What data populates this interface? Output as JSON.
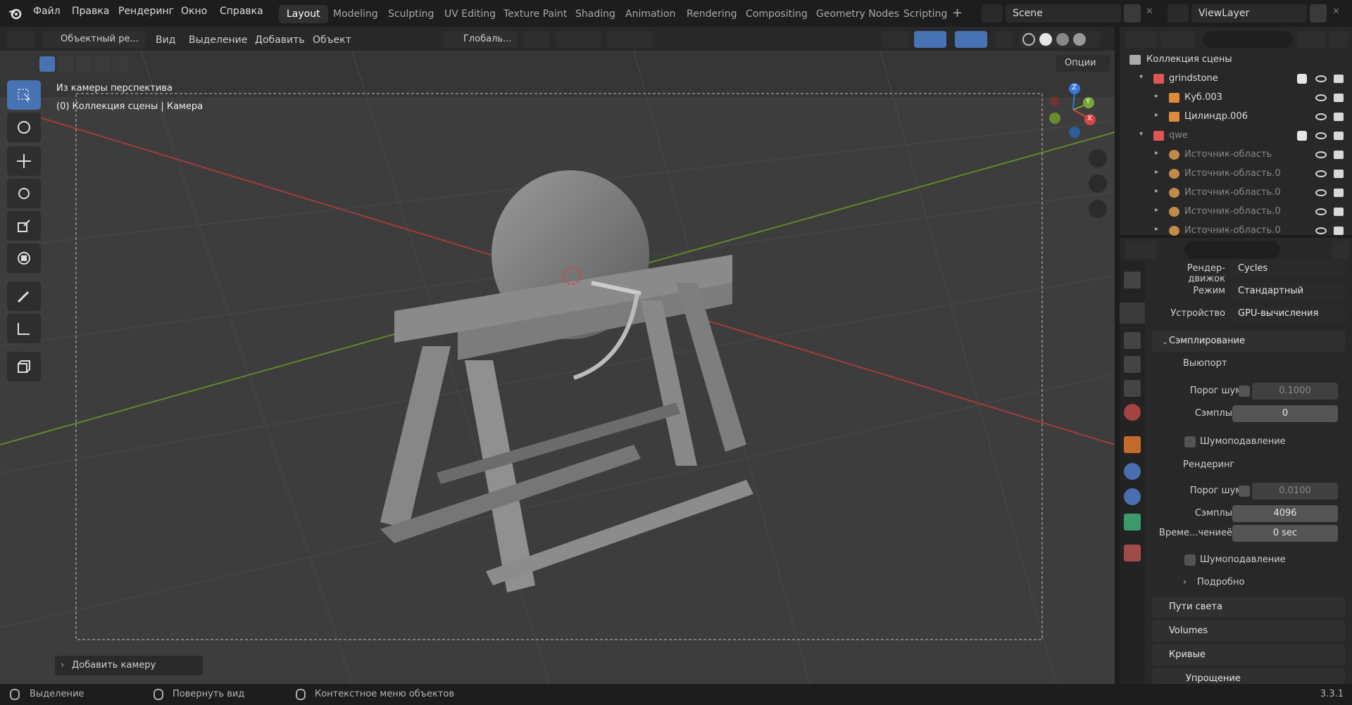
{
  "topbar": {
    "menus": [
      "Файл",
      "Правка",
      "Рендеринг",
      "Окно",
      "Справка"
    ],
    "workspaces": [
      "Layout",
      "Modeling",
      "Sculpting",
      "UV Editing",
      "Texture Paint",
      "Shading",
      "Animation",
      "Rendering",
      "Compositing",
      "Geometry Nodes",
      "Scripting"
    ],
    "scene_name": "Scene",
    "view_layer": "ViewLayer"
  },
  "viewport_header": {
    "mode": "Объектный ре...",
    "menus": [
      "Вид",
      "Выделение",
      "Добавить",
      "Объект"
    ],
    "orientation": "Глобаль...",
    "options": "Опции"
  },
  "viewport": {
    "view_name": "Из камеры перспектива",
    "collection_info": "(0) Коллекция сцены | Камера",
    "operator_panel": "Добавить камеру",
    "gizmo_axes": [
      "Z",
      "Y",
      "X"
    ]
  },
  "outliner": {
    "root": "Коллекция сцены",
    "items": [
      {
        "name": "grindstone",
        "type": "collection",
        "depth": 1
      },
      {
        "name": "Куб.003",
        "type": "mesh",
        "depth": 2
      },
      {
        "name": "Цилиндр.006",
        "type": "mesh",
        "depth": 2
      },
      {
        "name": "qwe",
        "type": "collection",
        "depth": 1
      },
      {
        "name": "Источник-область",
        "type": "light",
        "depth": 2
      },
      {
        "name": "Источник-область.0",
        "type": "light",
        "depth": 2
      },
      {
        "name": "Источник-область.0",
        "type": "light",
        "depth": 2
      },
      {
        "name": "Источник-область.0",
        "type": "light",
        "depth": 2
      },
      {
        "name": "Источник-область.0",
        "type": "light",
        "depth": 2
      }
    ]
  },
  "properties": {
    "render_engine_label": "Рендер-движок",
    "render_engine": "Cycles",
    "mode_label": "Режим",
    "mode": "Стандартный",
    "device_label": "Устройство",
    "device": "GPU-вычисления",
    "sampling": "Сэмплирование",
    "viewport": "Выюпорт",
    "noise_threshold_label": "Порог шума",
    "viewport_noise_threshold": "0.1000",
    "samples_label": "Сэмплы",
    "viewport_samples": "0",
    "denoise": "Шумоподавление",
    "render": "Рендеринг",
    "render_noise_threshold": "0.0100",
    "render_samples": "4096",
    "time_limit_label": "Време...чениеё",
    "time_limit": "0 sec",
    "advanced": "Подробно",
    "light_paths": "Пути света",
    "volumes": "Volumes",
    "curves": "Кривые",
    "simplify": "Упрощение"
  },
  "statusbar": {
    "select": "Выделение",
    "rotate": "Повернуть вид",
    "context": "Контекстное меню объектов",
    "version": "3.3.1"
  }
}
